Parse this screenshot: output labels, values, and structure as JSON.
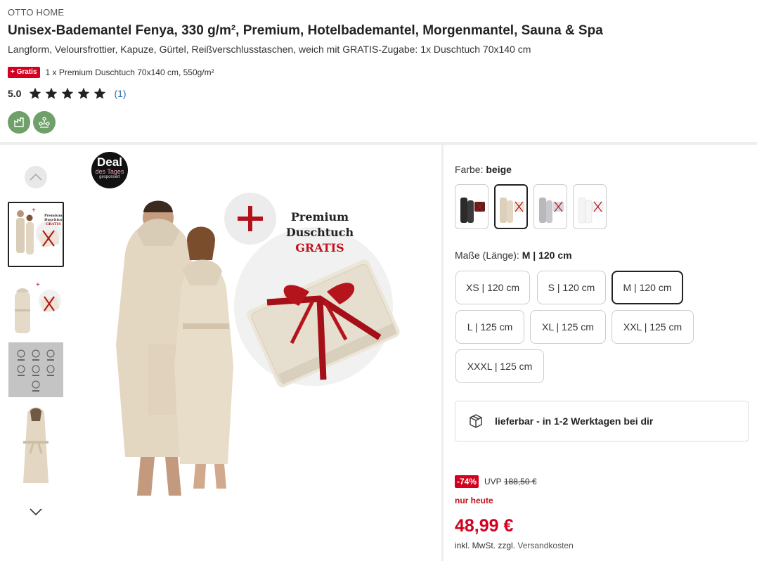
{
  "brand": "OTTO HOME",
  "title": "Unisex-Bademantel Fenya, 330 g/m², Premium, Hotelbademantel, Morgenmantel, Sauna & Spa",
  "subtitle": "Langform, Veloursfrottier, Kapuze, Gürtel, Reißverschlusstaschen, weich mit GRATIS-Zugabe: 1x Duschtuch 70x140 cm",
  "gratis": {
    "badge": "+ Gratis",
    "text": "1 x Premium Duschtuch 70x140 cm, 550g/m²"
  },
  "rating": {
    "value": "5.0",
    "stars": 5,
    "count": "(1)"
  },
  "eco_icons": [
    "sustainability-leaf-icon",
    "sustainability-people-icon"
  ],
  "deal": {
    "line1": "Deal",
    "line2": "des Tages",
    "line3": "gesponsert"
  },
  "promo": {
    "line1": "Premium",
    "line2": "Duschtuch",
    "line3": "GRATIS"
  },
  "color": {
    "label": "Farbe:",
    "value": "beige",
    "swatches": [
      "schwarz",
      "beige",
      "grau",
      "weiß"
    ],
    "selected_index": 1
  },
  "size": {
    "label": "Maße (Länge):",
    "value": "M | 120 cm",
    "options": [
      "XS | 120 cm",
      "S | 120 cm",
      "M | 120 cm",
      "L | 125 cm",
      "XL | 125 cm",
      "XXL | 125 cm",
      "XXXL | 125 cm"
    ],
    "selected_index": 2
  },
  "delivery": {
    "text": "lieferbar - in 1-2 Werktagen bei dir"
  },
  "price": {
    "discount": "-74%",
    "uvp_label": "UVP",
    "uvp_value": "188,50 €",
    "today": "nur heute",
    "current": "48,99 €",
    "tax": "inkl. MwSt. zzgl.",
    "shipping": "Versandkosten"
  },
  "colors": {
    "accent_red": "#d4001f",
    "link_blue": "#2a6fb8",
    "eco_green": "#6fa06a"
  }
}
